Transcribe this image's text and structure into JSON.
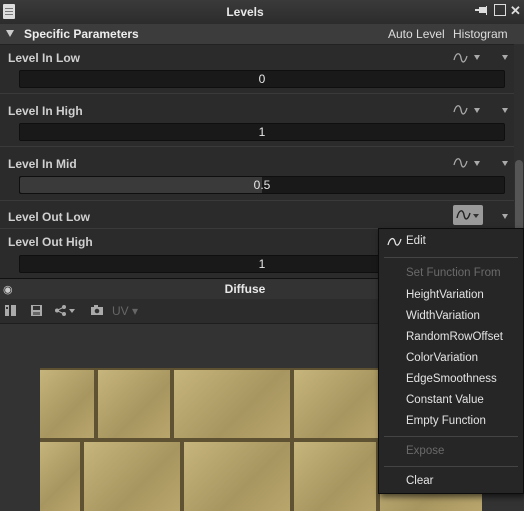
{
  "window": {
    "title": "Levels"
  },
  "section": {
    "label": "Specific Parameters",
    "auto_level": "Auto Level",
    "histogram": "Histogram"
  },
  "params": [
    {
      "label": "Level In Low",
      "value": "0",
      "fraction": 0.0
    },
    {
      "label": "Level In High",
      "value": "1",
      "fraction": 0.0
    },
    {
      "label": "Level In Mid",
      "value": "0.5",
      "fraction": 0.5
    },
    {
      "label": "Level Out Low"
    },
    {
      "label": "Level Out High",
      "value": "1",
      "fraction": 0.0
    }
  ],
  "viewer": {
    "title": "Diffuse",
    "uv_label": "UV"
  },
  "menu": {
    "edit": "Edit",
    "set_function_from": "Set Function From",
    "items": [
      "HeightVariation",
      "WidthVariation",
      "RandomRowOffset",
      "ColorVariation",
      "EdgeSmoothness",
      "Constant Value",
      "Empty Function"
    ],
    "expose": "Expose",
    "clear": "Clear"
  },
  "colors": {
    "panel_bg": "#2b2b2b",
    "slider_bg": "#191919",
    "menu_bg": "#262626",
    "texture": "#b7a36a"
  },
  "icons": [
    "document-icon",
    "pin-icon",
    "restore-icon",
    "close-icon",
    "function-icon",
    "dropdown-arrow-icon"
  ]
}
